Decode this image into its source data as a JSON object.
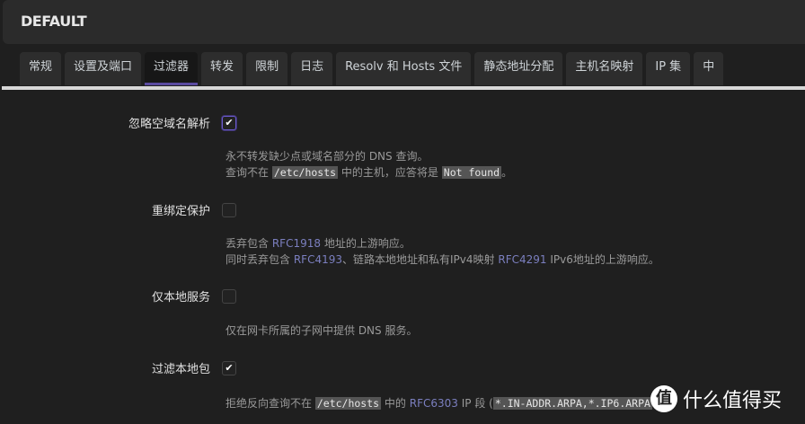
{
  "header": {
    "title": "DEFAULT"
  },
  "tabs": [
    "常规",
    "设置及端口",
    "过滤器",
    "转发",
    "限制",
    "日志",
    "Resolv 和 Hosts 文件",
    "静态地址分配",
    "主机名映射",
    "IP 集",
    "中"
  ],
  "active_tab": "过滤器",
  "accent": "#5a4aa0",
  "rows": [
    {
      "label": "忽略空域名解析",
      "checked": true,
      "desc1": "永不转发缺少点或域名部分的 DNS 查询。",
      "desc2a": "查询不在",
      "desc2code": "/etc/hosts",
      "desc2b": "中的主机，应答将是",
      "desc2code2": "Not found",
      "desc2c": "。"
    },
    {
      "label": "重绑定保护",
      "checked": false,
      "desc1a": "丢弃包含",
      "desc1link": "RFC1918",
      "desc1b": "地址的上游响应。",
      "desc2a": "同时丢弃包含",
      "desc2link": "RFC4193",
      "desc2b": "、链路本地地址和私有IPv4映射",
      "desc2link2": "RFC4291",
      "desc2c": "IPv6地址的上游响应。"
    },
    {
      "label": "仅本地服务",
      "checked": false,
      "desc1": "仅在网卡所属的子网中提供 DNS 服务。"
    },
    {
      "label": "过滤本地包",
      "checked": true,
      "desc1a": "拒绝反向查询不在",
      "desc1code": "/etc/hosts",
      "desc1b": "中的",
      "desc1link": "RFC6303",
      "desc1c": "IP 段 (",
      "desc1code2": "*.IN-ADDR.ARPA,*.IP6.ARPA"
    }
  ],
  "watermark": {
    "logo": "值",
    "text": "什么值得买"
  }
}
